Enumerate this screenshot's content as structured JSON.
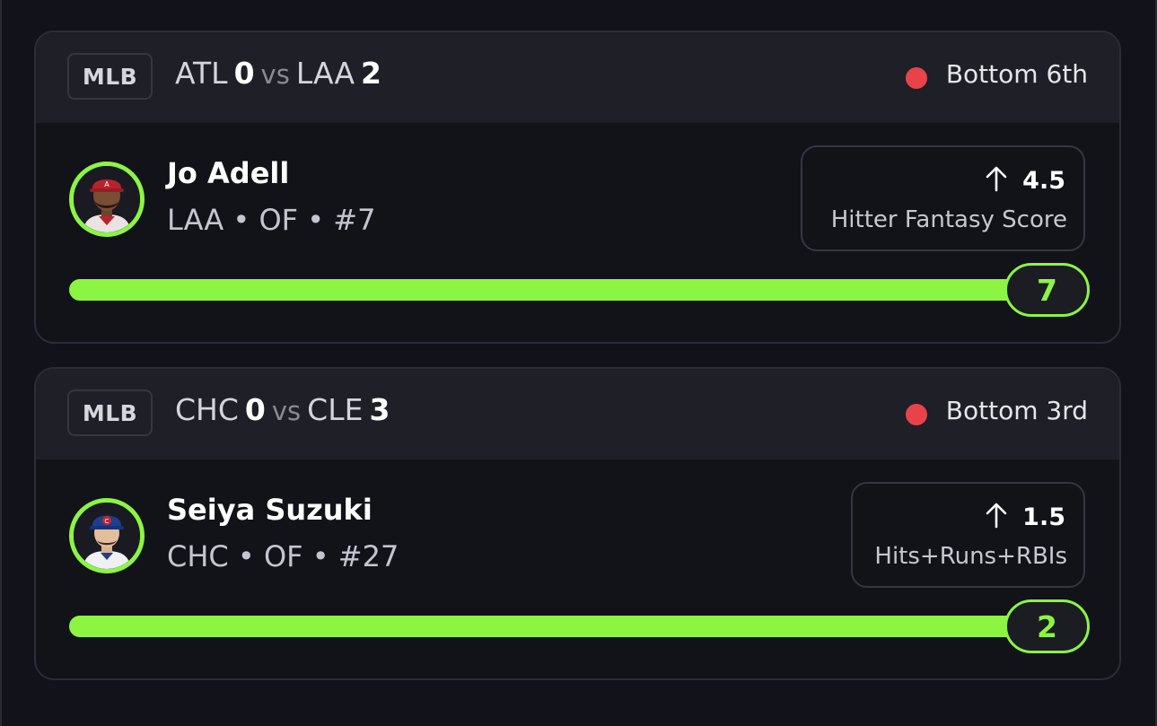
{
  "colors": {
    "background": "#12121a",
    "card_header": "#1f1f28",
    "accent_green": "#8cf542",
    "live_red": "#e8434a"
  },
  "cards": [
    {
      "league": "MLB",
      "away_team": "ATL",
      "away_score": "0",
      "vs": "vs",
      "home_team": "LAA",
      "home_score": "2",
      "status_icon": "live-dot-icon",
      "inning": "Bottom 6th",
      "player": {
        "name": "Jo Adell",
        "meta": "LAA • OF • #7",
        "avatar": "player-headshot-icon"
      },
      "stat": {
        "direction_icon": "arrow-up-icon",
        "line": "4.5",
        "label": "Hitter Fantasy Score"
      },
      "progress": {
        "current": "7",
        "fraction": 1.0
      }
    },
    {
      "league": "MLB",
      "away_team": "CHC",
      "away_score": "0",
      "vs": "vs",
      "home_team": "CLE",
      "home_score": "3",
      "status_icon": "live-dot-icon",
      "inning": "Bottom 3rd",
      "player": {
        "name": "Seiya Suzuki",
        "meta": "CHC • OF • #27",
        "avatar": "player-headshot-icon"
      },
      "stat": {
        "direction_icon": "arrow-up-icon",
        "line": "1.5",
        "label": "Hits+Runs+RBIs"
      },
      "progress": {
        "current": "2",
        "fraction": 1.0
      }
    }
  ]
}
